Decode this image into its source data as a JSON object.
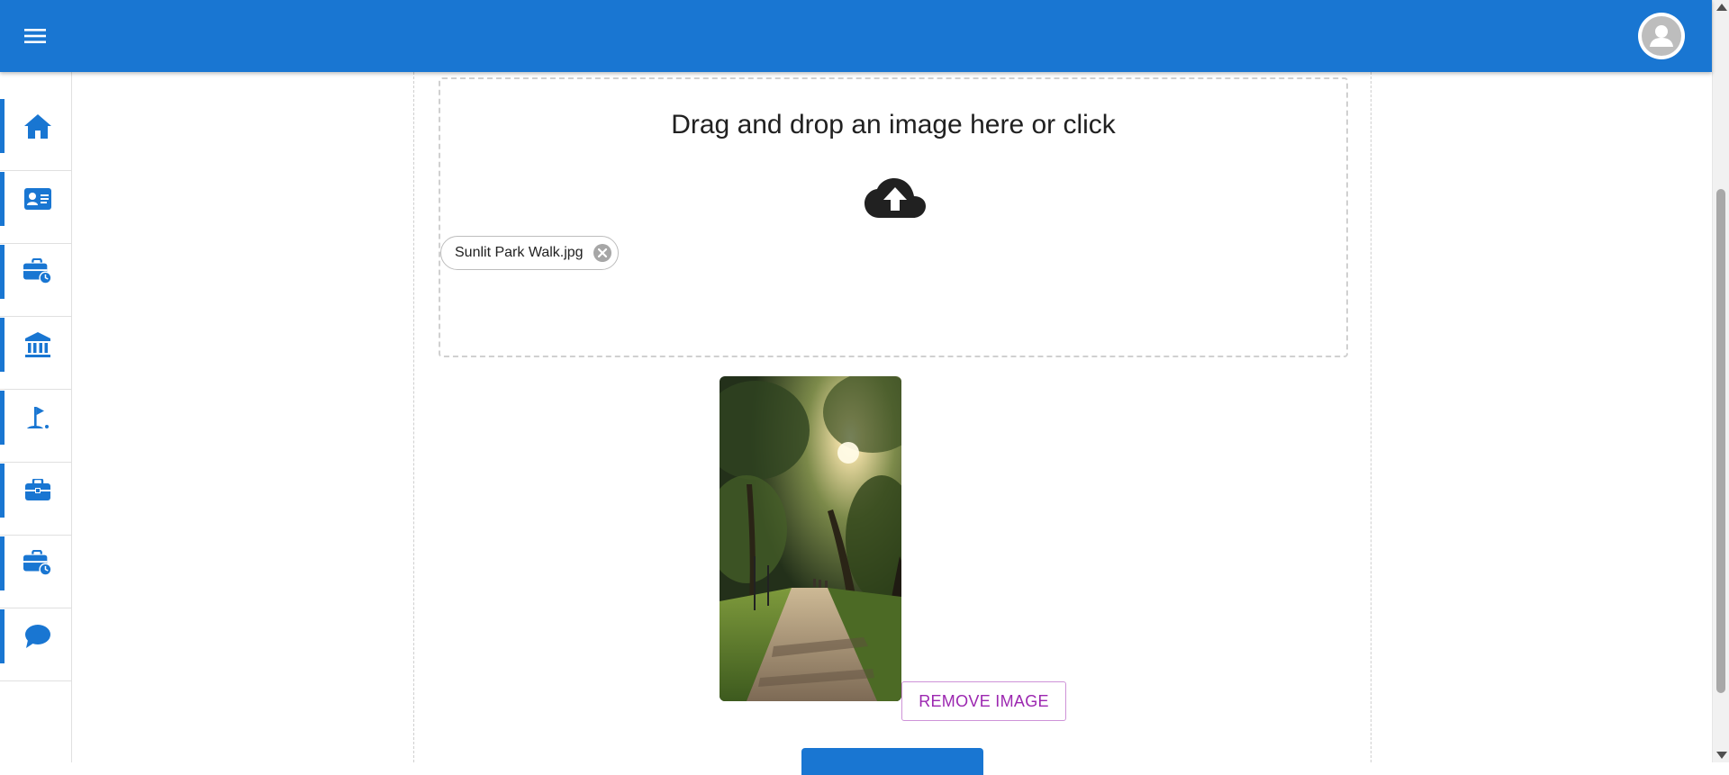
{
  "appbar": {
    "color": "#1976d2",
    "menu_icon": "hamburger-menu-icon",
    "account_icon": "account-circle-icon"
  },
  "sidebar": {
    "items": [
      {
        "icon": "home-icon"
      },
      {
        "icon": "contact-card-icon"
      },
      {
        "icon": "work-history-icon"
      },
      {
        "icon": "bank-icon"
      },
      {
        "icon": "golf-icon"
      },
      {
        "icon": "briefcase-icon"
      },
      {
        "icon": "work-history-icon"
      },
      {
        "icon": "chat-bubble-icon"
      }
    ]
  },
  "dropzone": {
    "text": "Drag and drop an image here or click",
    "icon": "cloud-upload-icon",
    "file_chip": {
      "label": "Sunlit Park Walk.jpg",
      "delete_icon": "cancel-icon"
    }
  },
  "preview": {
    "remove_label": "REMOVE IMAGE",
    "remove_color": "#9c27b0"
  }
}
